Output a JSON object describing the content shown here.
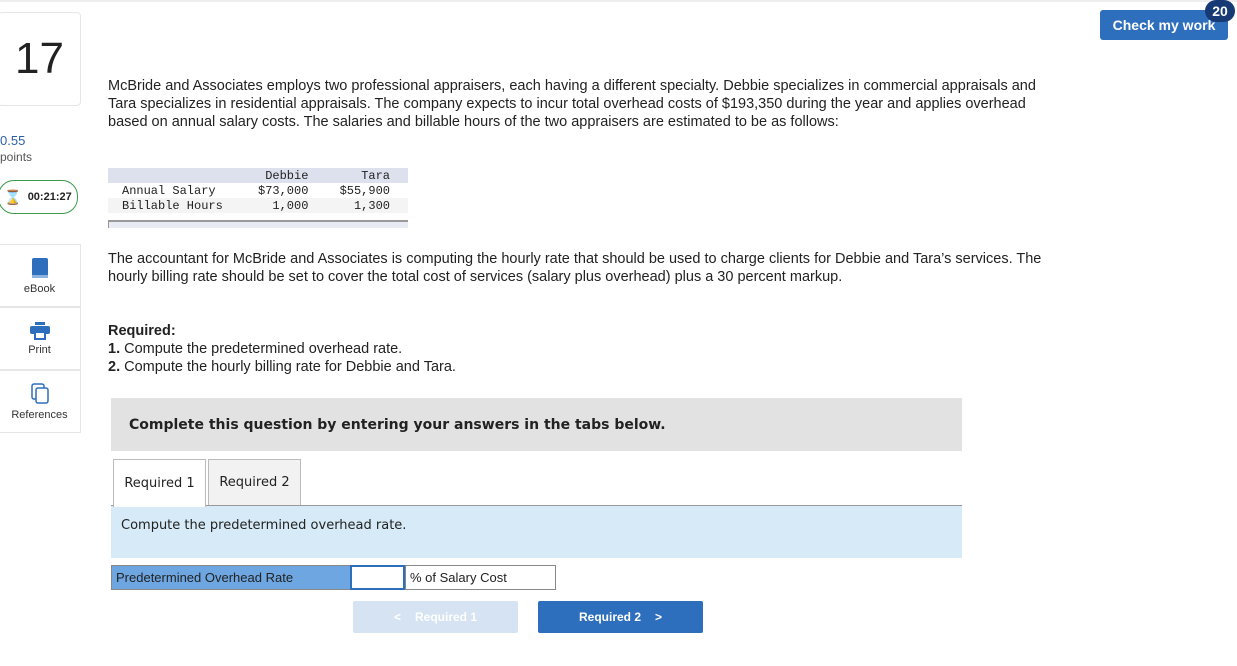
{
  "question": {
    "number": "17",
    "points": "0.55",
    "points_label": "points",
    "timer": "00:21:27"
  },
  "sidebar": [
    {
      "label": "eBook"
    },
    {
      "label": "Print"
    },
    {
      "label": "References"
    }
  ],
  "header": {
    "check_label": "Check my work",
    "check_count": "20"
  },
  "intro": "McBride and Associates employs two professional appraisers, each having a different specialty. Debbie specializes in commercial appraisals and Tara specializes in residential appraisals. The company expects to incur total overhead costs of $193,350 during the year and applies overhead based on annual salary costs. The salaries and billable hours of the two appraisers are estimated to be as follows:",
  "table": {
    "headers": [
      "",
      "Debbie",
      "Tara"
    ],
    "rows": [
      [
        "Annual Salary",
        "$73,000",
        "$55,900"
      ],
      [
        "Billable Hours",
        "1,000",
        "1,300"
      ]
    ]
  },
  "para2": "The accountant for McBride and Associates is computing the hourly rate that should be used to charge clients for Debbie and Tara’s services. The hourly billing rate should be set to cover the total cost of services (salary plus overhead) plus a 30 percent markup.",
  "required": {
    "title": "Required:",
    "items": [
      {
        "num": "1.",
        "text": " Compute the predetermined overhead rate."
      },
      {
        "num": "2.",
        "text": " Compute the hourly billing rate for Debbie and Tara."
      }
    ]
  },
  "instructions": "Complete this question by entering your answers in the tabs below.",
  "tabs": [
    {
      "label": "Required 1"
    },
    {
      "label": "Required 2"
    }
  ],
  "panel": {
    "prompt": "Compute the predetermined overhead rate.",
    "row_label": "Predetermined Overhead Rate",
    "input_value": "",
    "unit": "% of Salary Cost"
  },
  "nav": {
    "prev": "Required 1",
    "next": "Required 2"
  }
}
